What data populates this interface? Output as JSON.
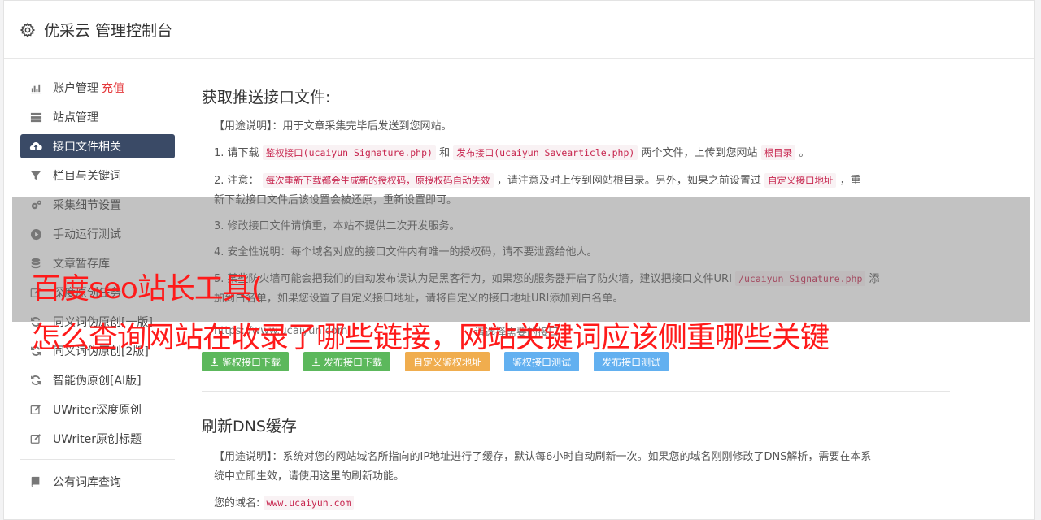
{
  "header": {
    "title": "优采云 管理控制台"
  },
  "sidebar": {
    "items": [
      {
        "label": "账户管理",
        "tag": "充值",
        "icon": "bar-chart-icon"
      },
      {
        "label": "站点管理",
        "icon": "server-icon"
      },
      {
        "label": "接口文件相关",
        "icon": "cloud-upload-icon",
        "active": true
      },
      {
        "label": "栏目与关键词",
        "icon": "filter-icon"
      },
      {
        "label": "采集细节设置",
        "icon": "cogs-icon"
      },
      {
        "label": "手动运行测试",
        "icon": "play-circle-icon"
      },
      {
        "label": "文章暂存库",
        "icon": "database-icon"
      },
      {
        "label": "深度原创任务",
        "icon": "edit-icon"
      },
      {
        "label": "同义词伪原创[一版]",
        "icon": "refresh-icon"
      },
      {
        "label": "同义词伪原创[2版]",
        "icon": "refresh-icon"
      },
      {
        "label": "智能伪原创[AI版]",
        "icon": "refresh-icon"
      },
      {
        "label": "UWriter深度原创",
        "icon": "edit-icon"
      },
      {
        "label": "UWriter原创标题",
        "icon": "edit-icon"
      },
      {
        "label": "公有词库查询",
        "icon": "book-icon"
      }
    ]
  },
  "section1": {
    "title": "获取推送接口文件:",
    "usage": "【用途说明】：用于文章采集完毕后发送到您网站。",
    "l1_a": "1. 请下载",
    "l1_code1": "鉴权接口(ucaiyun_Signature.php)",
    "l1_b": "和",
    "l1_code2": "发布接口(ucaiyun_Savearticle.php)",
    "l1_c": "两个文件，上传到您网站",
    "l1_code3": "根目录",
    "l1_d": "。",
    "l2_a": "2. 注意：",
    "l2_code1": "每次重新下载都会生成新的授权码，原授权码自动失效",
    "l2_b": "，请注意及时上传到网站根目录。另外，如果之前设置过",
    "l2_code2": "自定义接口地址",
    "l2_c": "，重",
    "l2_d": "新下载接口文件后该设置会被还原，重新设置即可。",
    "l3": "3. 修改接口文件请慎重，本站不提供二次开发服务。",
    "l4": "4. 安全性说明：每个域名对应的接口文件内有唯一的授权码，请不要泄露给他人。",
    "l5_a": "5. 某些防火墙可能会把我们的自动发布误认为是黑客行为，如果您的服务器开启了防火墙，建议把接口文件URI",
    "l5_code": "/ucaiyun_Signature.php",
    "l5_b": "添",
    "l6": "加到白名单，如果您设置了自定义接口地址，请将自定义的接口地址URI添加到白名单。",
    "url_value": "https://www.ucaiyun.com",
    "url_hint": "请选择需要的接口",
    "buttons": {
      "b1": "鉴权接口下载",
      "b2": "发布接口下载",
      "b3": "自定义鉴权地址",
      "b4": "鉴权接口测试",
      "b5": "发布接口测试"
    }
  },
  "section2": {
    "title": "刷新DNS缓存",
    "usage1": "【用途说明】：系统对您的网站域名所指向的IP地址进行了缓存，默认每6小时自动刷新一次。如果您的域名刚刚修改了DNS解析，需要在本系",
    "usage2": "统中立即生效，请使用这里的刷新功能。",
    "domain_label": "您的域名:",
    "domain_value": "www.ucaiyun.com"
  },
  "overlay": {
    "line1": "百度seo站长工具(",
    "line2": "怎么查询网站在收录了哪些链接，网站关键词应该侧重哪些关键"
  }
}
